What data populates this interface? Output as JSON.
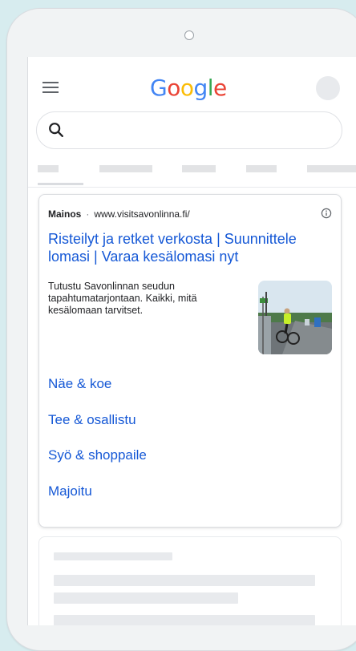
{
  "header": {
    "logo_letters": [
      {
        "char": "G",
        "color": "#4285f4"
      },
      {
        "char": "o",
        "color": "#ea4335"
      },
      {
        "char": "o",
        "color": "#fbbc05"
      },
      {
        "char": "g",
        "color": "#4285f4"
      },
      {
        "char": "l",
        "color": "#34a853"
      },
      {
        "char": "e",
        "color": "#ea4335"
      }
    ],
    "menu_icon": "hamburger-menu-icon",
    "avatar_icon": "account-avatar"
  },
  "search": {
    "icon": "search-icon",
    "value": ""
  },
  "ad": {
    "label": "Mainos",
    "separator": "·",
    "url": "www.visitsavonlinna.fi/",
    "title": "Risteilyt ja retket verkosta | Suunnittele lomasi | Varaa kesälomasi nyt",
    "description": "Tutustu Savonlinnan seudun tapahtumatarjontaan. Kaikki, mitä kesälomaan tarvitset.",
    "info_icon": "info-icon",
    "image_icon": "cyclist-on-bridge-photo",
    "sitelinks": [
      {
        "label": "Näe & koe"
      },
      {
        "label": "Tee & osallistu"
      },
      {
        "label": "Syö & shoppaile"
      },
      {
        "label": "Majoitu"
      }
    ]
  },
  "colors": {
    "link": "#1558d6",
    "background": "#d7ecef"
  }
}
